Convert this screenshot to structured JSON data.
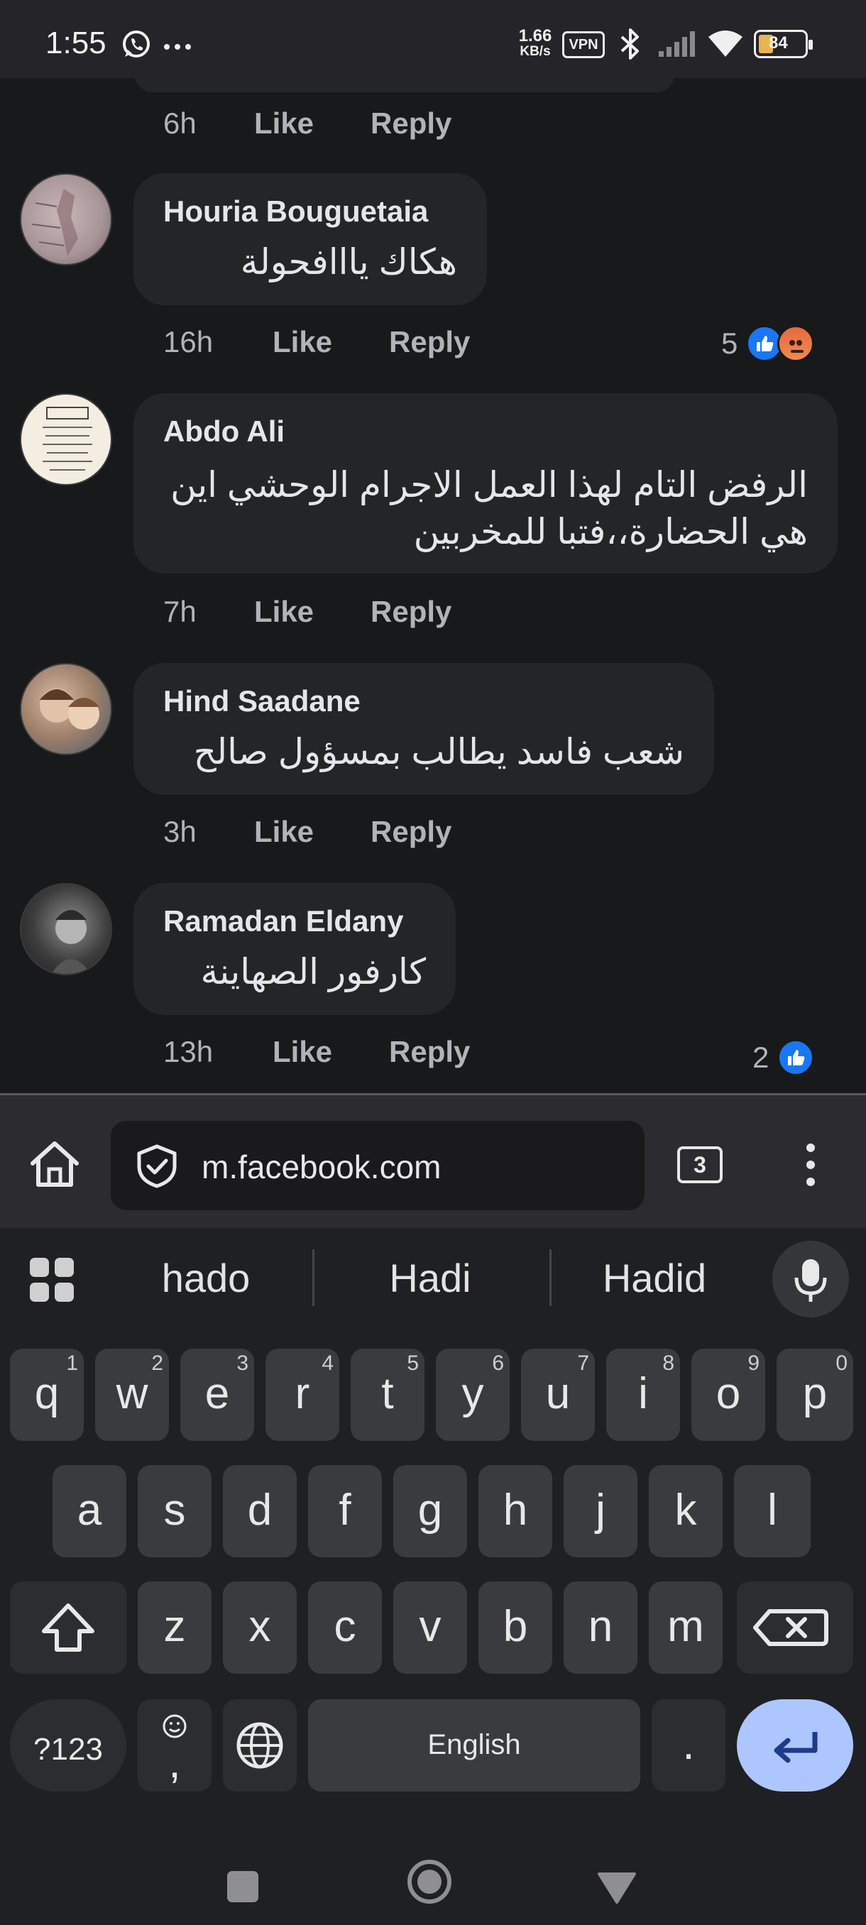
{
  "status_bar": {
    "time": "1:55",
    "net_speed_value": "1.66",
    "net_speed_unit": "KB/s",
    "vpn": "VPN",
    "battery": "84"
  },
  "comments": {
    "prev_comment": {
      "time": "6h",
      "like": "Like",
      "reply": "Reply"
    },
    "items": [
      {
        "author": "Houria Bouguetaia",
        "text": "هكاك يااافحولة",
        "time": "16h",
        "like": "Like",
        "reply": "Reply",
        "reaction_count": "5"
      },
      {
        "author": "Abdo Ali",
        "text_line1": "الرفض التام لهذا العمل الاجرام الوحشي اين",
        "text_line2": "هي الحضارة،،فتبا للمخربين",
        "time": "7h",
        "like": "Like",
        "reply": "Reply"
      },
      {
        "author": "Hind Saadane",
        "text": "شعب فاسد يطالب بمسؤول صالح",
        "time": "3h",
        "like": "Like",
        "reply": "Reply"
      },
      {
        "author": "Ramadan Eldany",
        "text": "كارفور الصهاينة",
        "time": "13h",
        "like": "Like",
        "reply": "Reply",
        "reaction_count": "2"
      }
    ]
  },
  "browser": {
    "url": "m.facebook.com",
    "tab_count": "3"
  },
  "keyboard": {
    "suggestions": [
      "hado",
      "Hadi",
      "Hadid"
    ],
    "row1": [
      {
        "k": "q",
        "h": "1"
      },
      {
        "k": "w",
        "h": "2"
      },
      {
        "k": "e",
        "h": "3"
      },
      {
        "k": "r",
        "h": "4"
      },
      {
        "k": "t",
        "h": "5"
      },
      {
        "k": "y",
        "h": "6"
      },
      {
        "k": "u",
        "h": "7"
      },
      {
        "k": "i",
        "h": "8"
      },
      {
        "k": "o",
        "h": "9"
      },
      {
        "k": "p",
        "h": "0"
      }
    ],
    "row2": [
      "a",
      "s",
      "d",
      "f",
      "g",
      "h",
      "j",
      "k",
      "l"
    ],
    "row3": [
      "z",
      "x",
      "c",
      "v",
      "b",
      "n",
      "m"
    ],
    "symbols_label": "?123",
    "comma": ",",
    "space_label": "English",
    "period": "."
  },
  "colors": {
    "background": "#18191a",
    "bubble": "#242526",
    "like_blue": "#1877f2",
    "enter_key": "#aec6ff"
  }
}
